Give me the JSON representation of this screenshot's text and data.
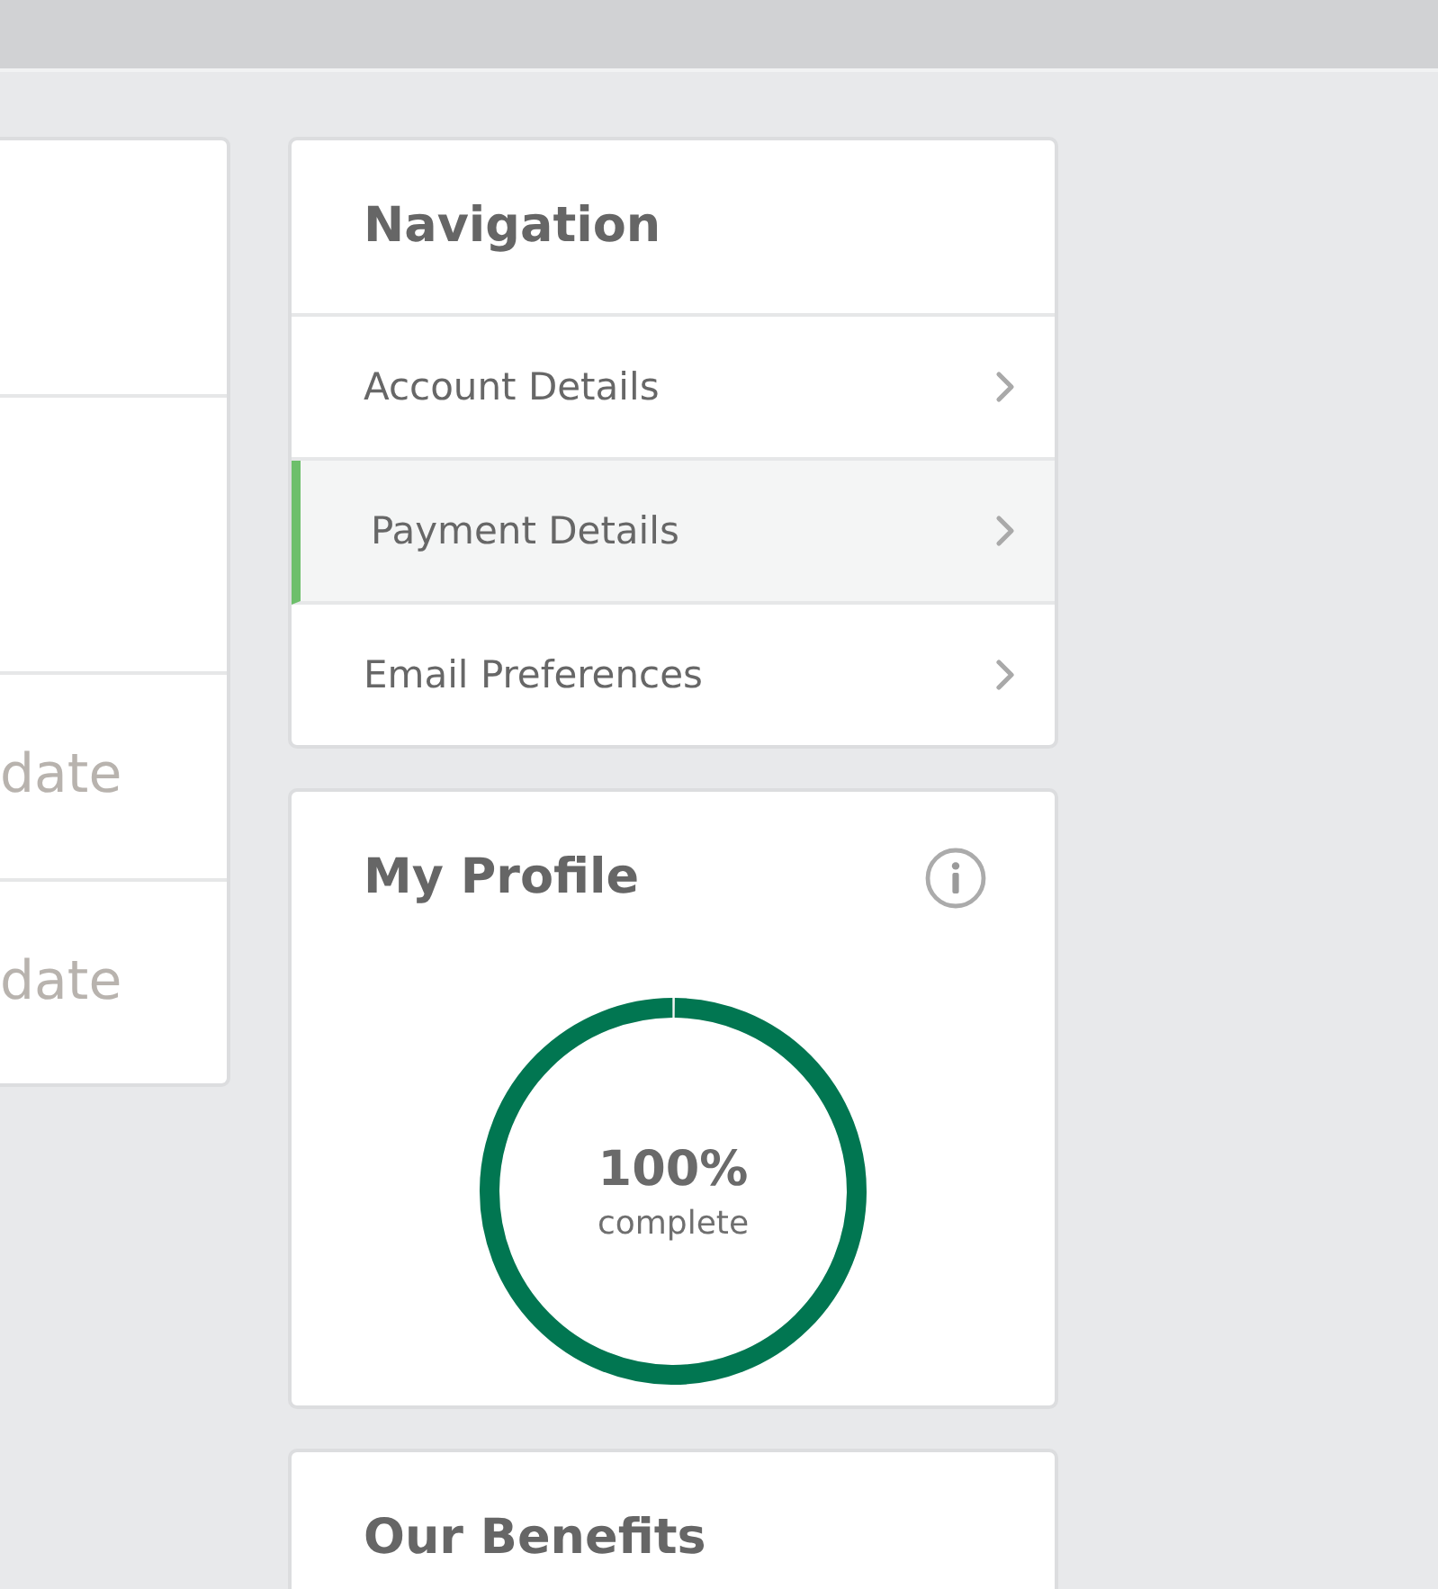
{
  "left_card": {
    "rows": [
      {
        "value": "date"
      },
      {
        "value": "date"
      }
    ]
  },
  "navigation": {
    "title": "Navigation",
    "items": [
      {
        "label": "Account Details",
        "selected": false
      },
      {
        "label": "Payment Details",
        "selected": true
      },
      {
        "label": "Email Preferences",
        "selected": false
      }
    ]
  },
  "profile": {
    "title": "My Profile",
    "level": 1,
    "percent": "100%",
    "caption": "complete"
  },
  "benefits": {
    "title": "Our Benefits"
  }
}
